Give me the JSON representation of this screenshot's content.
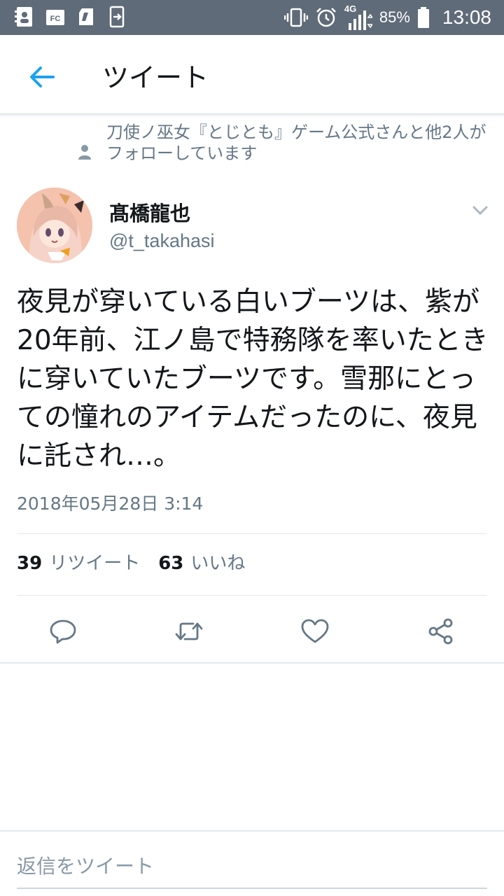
{
  "status_bar": {
    "battery": "85%",
    "network": "4G",
    "time": "13:08"
  },
  "header": {
    "title": "ツイート"
  },
  "social_context": {
    "text": "刀使ノ巫女『とじとも』ゲーム公式さんと他2人がフォローしています"
  },
  "author": {
    "name": "髙橋龍也",
    "handle": "@t_takahasi"
  },
  "tweet": {
    "text": "夜見が穿いている白いブーツは、紫が20年前、江ノ島で特務隊を率いたときに穿いていたブーツです。雪那にとっての憧れのアイテムだったのに、夜見に託され…。",
    "timestamp": "2018年05月28日 3:14"
  },
  "stats": {
    "retweets_count": "39",
    "retweets_label": "リツイート",
    "likes_count": "63",
    "likes_label": "いいね"
  },
  "actions": {
    "icons": [
      "reply-icon",
      "retweet-icon",
      "like-icon",
      "share-icon"
    ]
  },
  "reply": {
    "placeholder": "返信をツイート"
  },
  "colors": {
    "accent": "#1da1f2",
    "status_bar": "#5f6b78",
    "secondary_text": "#657786",
    "divider": "#e1e8ed"
  }
}
